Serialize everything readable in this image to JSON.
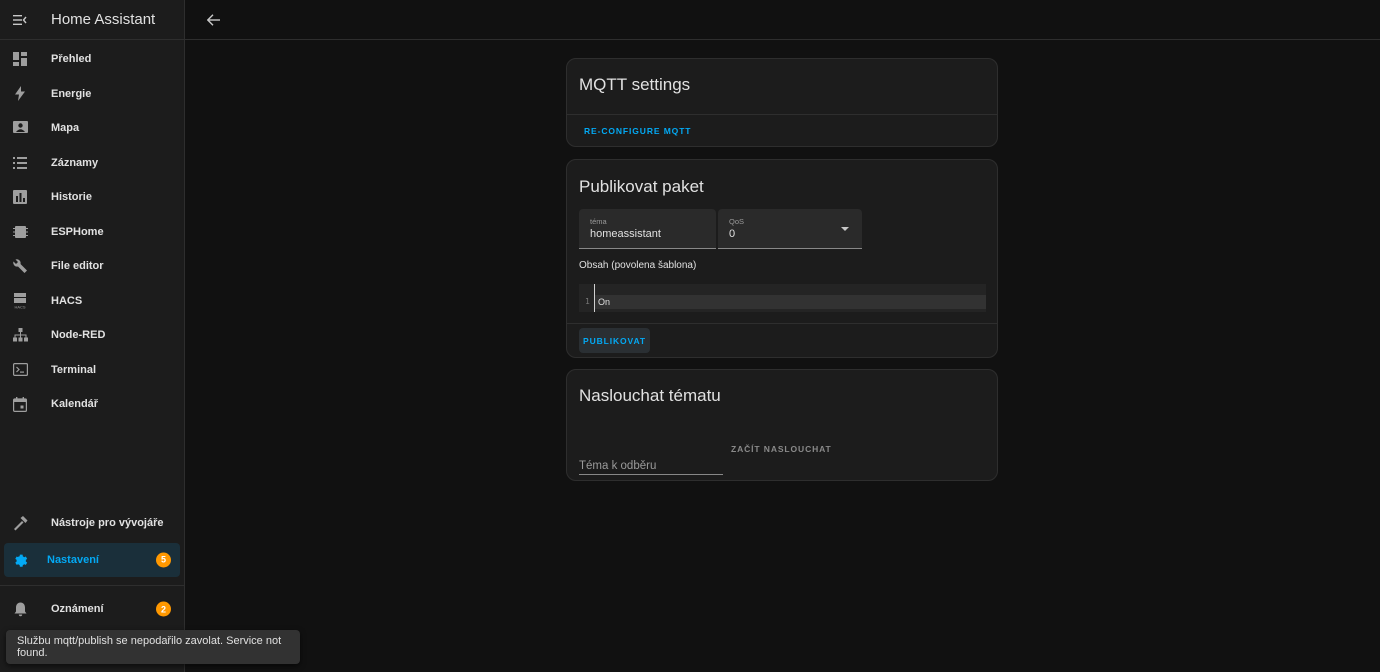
{
  "app": {
    "title": "Home Assistant"
  },
  "sidebar": {
    "items": [
      {
        "label": "Přehled",
        "icon": "dashboard-icon"
      },
      {
        "label": "Energie",
        "icon": "lightning-icon"
      },
      {
        "label": "Mapa",
        "icon": "map-account-icon"
      },
      {
        "label": "Záznamy",
        "icon": "list-icon"
      },
      {
        "label": "Historie",
        "icon": "chart-box-icon"
      },
      {
        "label": "ESPHome",
        "icon": "chip-icon"
      },
      {
        "label": "File editor",
        "icon": "wrench-icon"
      },
      {
        "label": "HACS",
        "icon": "hacs-icon"
      },
      {
        "label": "Node-RED",
        "icon": "sitemap-icon"
      },
      {
        "label": "Terminal",
        "icon": "console-icon"
      },
      {
        "label": "Kalendář",
        "icon": "calendar-icon"
      }
    ],
    "dev_tools": {
      "label": "Nástroje pro vývojáře",
      "icon": "hammer-icon"
    },
    "settings": {
      "label": "Nastavení",
      "icon": "gear-icon",
      "badge": "5"
    },
    "notifications": {
      "label": "Oznámení",
      "icon": "bell-icon",
      "badge": "2"
    }
  },
  "mqtt_settings": {
    "title": "MQTT settings",
    "reconfigure_label": "RE-CONFIGURE MQTT"
  },
  "publish": {
    "title": "Publikovat paket",
    "topic_label": "téma",
    "topic_value": "homeassistant",
    "qos_label": "QoS",
    "qos_value": "0",
    "payload_label": "Obsah (povolena šablona)",
    "line_number": "1",
    "payload_value": "On",
    "publish_label": "PUBLIKOVAT"
  },
  "listen": {
    "title": "Naslouchat tématu",
    "topic_placeholder": "Téma k odběru",
    "start_label": "ZAČÍT NASLOUCHAT"
  },
  "toast": {
    "message": "Službu mqtt/publish se nepodařilo zavolat. Service not found."
  },
  "colors": {
    "accent": "#03a9f4",
    "badge": "#ff9800",
    "background": "#111111",
    "card": "#1c1c1c"
  }
}
